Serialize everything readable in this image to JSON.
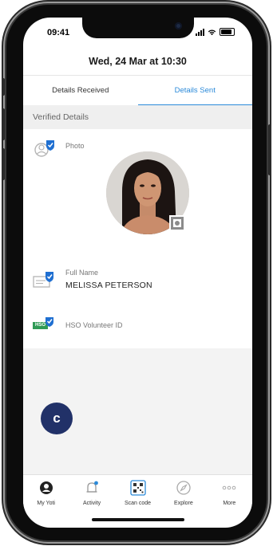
{
  "status_bar": {
    "time": "09:41"
  },
  "header": {
    "title": "Wed, 24 Mar at 10:30"
  },
  "tabs": [
    {
      "label": "Details Received",
      "active": false
    },
    {
      "label": "Details Sent",
      "active": true
    }
  ],
  "section": {
    "title": "Verified Details"
  },
  "details": {
    "photo_label": "Photo",
    "full_name_label": "Full Name",
    "full_name_value": "MELISSA PETERSON",
    "hso_label": "HSO Volunteer ID",
    "hso_icon_text": "HSO"
  },
  "callout": {
    "letter": "c"
  },
  "bottom_nav": [
    {
      "label": "My Yoti",
      "icon": "my-yoti-icon"
    },
    {
      "label": "Activity",
      "icon": "bell-icon"
    },
    {
      "label": "Scan code",
      "icon": "qr-code-icon"
    },
    {
      "label": "Explore",
      "icon": "compass-icon"
    },
    {
      "label": "More",
      "icon": "more-dots-icon"
    }
  ],
  "colors": {
    "accent": "#2b8ad9",
    "verified": "#1f6fd1",
    "callout": "#213168",
    "hso_green": "#2f9a55"
  }
}
